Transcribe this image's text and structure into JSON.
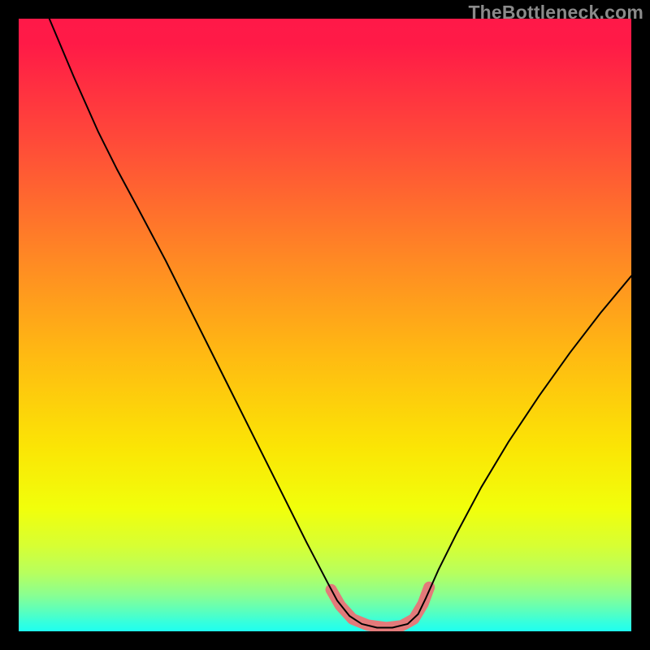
{
  "watermark": "TheBottleneck.com",
  "chart_data": {
    "type": "line",
    "title": "",
    "xlabel": "",
    "ylabel": "",
    "xlim": [
      0,
      1
    ],
    "ylim": [
      0,
      1
    ],
    "background_gradient": {
      "stops": [
        {
          "offset": 0.0,
          "color": "#ff1948"
        },
        {
          "offset": 0.04,
          "color": "#ff1a47"
        },
        {
          "offset": 0.2,
          "color": "#ff4a39"
        },
        {
          "offset": 0.4,
          "color": "#ff8b23"
        },
        {
          "offset": 0.55,
          "color": "#ffba12"
        },
        {
          "offset": 0.7,
          "color": "#fbe505"
        },
        {
          "offset": 0.8,
          "color": "#f1ff0b"
        },
        {
          "offset": 0.86,
          "color": "#d7ff33"
        },
        {
          "offset": 0.905,
          "color": "#b7ff5e"
        },
        {
          "offset": 0.94,
          "color": "#8bff90"
        },
        {
          "offset": 0.965,
          "color": "#5effba"
        },
        {
          "offset": 0.985,
          "color": "#36ffdd"
        },
        {
          "offset": 1.0,
          "color": "#1fffef"
        }
      ]
    },
    "series": [
      {
        "name": "bottleneck-curve",
        "stroke": "#000000",
        "stroke_width": 2,
        "points": [
          {
            "x": 0.05,
            "y": 1.0
          },
          {
            "x": 0.09,
            "y": 0.905
          },
          {
            "x": 0.13,
            "y": 0.815
          },
          {
            "x": 0.16,
            "y": 0.755
          },
          {
            "x": 0.195,
            "y": 0.69
          },
          {
            "x": 0.24,
            "y": 0.605
          },
          {
            "x": 0.29,
            "y": 0.505
          },
          {
            "x": 0.34,
            "y": 0.405
          },
          {
            "x": 0.39,
            "y": 0.305
          },
          {
            "x": 0.43,
            "y": 0.225
          },
          {
            "x": 0.47,
            "y": 0.145
          },
          {
            "x": 0.505,
            "y": 0.078
          },
          {
            "x": 0.52,
            "y": 0.05
          },
          {
            "x": 0.54,
            "y": 0.025
          },
          {
            "x": 0.56,
            "y": 0.012
          },
          {
            "x": 0.585,
            "y": 0.006
          },
          {
            "x": 0.61,
            "y": 0.006
          },
          {
            "x": 0.635,
            "y": 0.012
          },
          {
            "x": 0.652,
            "y": 0.028
          },
          {
            "x": 0.665,
            "y": 0.055
          },
          {
            "x": 0.685,
            "y": 0.1
          },
          {
            "x": 0.715,
            "y": 0.16
          },
          {
            "x": 0.755,
            "y": 0.235
          },
          {
            "x": 0.8,
            "y": 0.31
          },
          {
            "x": 0.85,
            "y": 0.385
          },
          {
            "x": 0.9,
            "y": 0.455
          },
          {
            "x": 0.95,
            "y": 0.52
          },
          {
            "x": 1.0,
            "y": 0.58
          }
        ]
      },
      {
        "name": "highlight-band",
        "stroke": "#e37a7a",
        "stroke_width": 14,
        "points": [
          {
            "x": 0.51,
            "y": 0.068
          },
          {
            "x": 0.525,
            "y": 0.042
          },
          {
            "x": 0.545,
            "y": 0.02
          },
          {
            "x": 0.57,
            "y": 0.01
          },
          {
            "x": 0.6,
            "y": 0.006
          },
          {
            "x": 0.625,
            "y": 0.009
          },
          {
            "x": 0.645,
            "y": 0.02
          },
          {
            "x": 0.66,
            "y": 0.045
          },
          {
            "x": 0.67,
            "y": 0.072
          }
        ]
      }
    ]
  }
}
